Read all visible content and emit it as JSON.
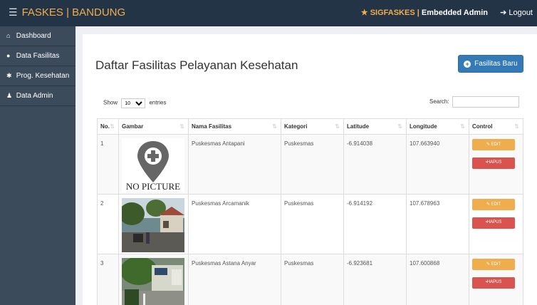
{
  "topbar": {
    "menu_icon": "☰",
    "brand": "FASKES | BANDUNG",
    "app_name": "SIGFASKES",
    "separator": " | ",
    "user": "Embedded Admin",
    "logout_label": "Logout"
  },
  "sidebar": {
    "items": [
      {
        "icon": "home-icon",
        "glyph": "⌂",
        "label": "Dashboard"
      },
      {
        "icon": "map-marker-icon",
        "glyph": "●",
        "label": "Data Fasilitas"
      },
      {
        "icon": "asterisk-icon",
        "glyph": "✱",
        "label": "Prog. Kesehatan"
      },
      {
        "icon": "user-icon",
        "glyph": "♟",
        "label": "Data Admin"
      }
    ]
  },
  "main": {
    "title": "Daftar Fasilitas Pelayanan Kesehatan",
    "new_button": "Fasilitas Baru",
    "show_label": "Show",
    "entries_value": "10",
    "entries_label": "entries",
    "search_label": "Search:",
    "columns": [
      "No.",
      "Gambar",
      "Nama Fasilitas",
      "Kategori",
      "Latitude",
      "Longitude",
      "Control"
    ],
    "rows": [
      {
        "no": "1",
        "image": "no-picture",
        "name": "Puskesmas Antapani",
        "kategori": "Puskesmas",
        "lat": "-6.914038",
        "lng": "107.663940"
      },
      {
        "no": "2",
        "image": "photo",
        "name": "Puskesmas Arcamanik",
        "kategori": "Puskesmas",
        "lat": "-6.914192",
        "lng": "107.678963"
      },
      {
        "no": "3",
        "image": "photo",
        "name": "Puskesmas Astana Anyar",
        "kategori": "Puskesmas",
        "lat": "-6.923681",
        "lng": "107.600868"
      }
    ],
    "no_picture_text": "NO PICTURE",
    "edit_label": "EDIT",
    "hapus_label": "HAPUS"
  },
  "colors": {
    "navbar": "#243447",
    "sidebar": "#3b4b5c",
    "brand": "#f0ad4e",
    "primary": "#337ab7",
    "warning": "#f0ad4e",
    "danger": "#d9534f"
  }
}
